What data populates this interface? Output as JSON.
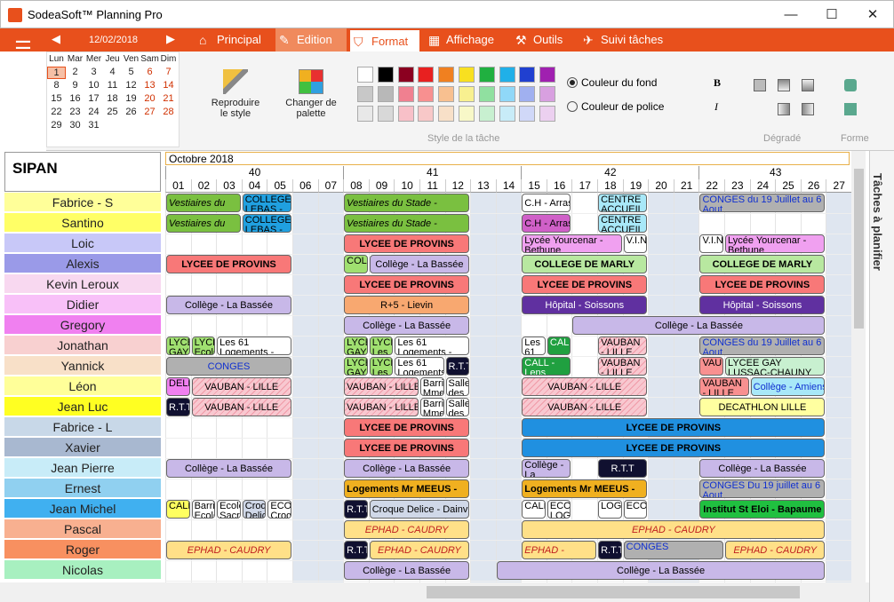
{
  "app": {
    "title": "SodeaSoft™ Planning Pro",
    "controls": [
      "—",
      "☐",
      "✕"
    ]
  },
  "nav": {
    "date": "12/02/2018",
    "prev": "◀",
    "next": "▶",
    "menu": "☰"
  },
  "tabs": [
    {
      "label": "Principal",
      "icon": "⌂"
    },
    {
      "label": "Edition",
      "icon": "✎"
    },
    {
      "label": "Format",
      "icon": "⛉"
    },
    {
      "label": "Affichage",
      "icon": "▦"
    },
    {
      "label": "Outils",
      "icon": "⚒"
    },
    {
      "label": "Suivi tâches",
      "icon": "✈"
    }
  ],
  "calendar": {
    "headers": [
      "Lun",
      "Mar",
      "Mer",
      "Jeu",
      "Ven",
      "Sam",
      "Dim"
    ],
    "weeks": [
      [
        "1",
        "2",
        "3",
        "4",
        "5",
        "6",
        "7"
      ],
      [
        "8",
        "9",
        "10",
        "11",
        "12",
        "13",
        "14"
      ],
      [
        "15",
        "16",
        "17",
        "18",
        "19",
        "20",
        "21"
      ],
      [
        "22",
        "23",
        "24",
        "25",
        "26",
        "27",
        "28"
      ],
      [
        "29",
        "30",
        "31",
        "",
        "",
        "",
        ""
      ]
    ]
  },
  "ribbon": {
    "reproduce": "Reproduire le style",
    "palette": "Changer de palette",
    "style_group": "Style de la tâche",
    "gradient_group": "Dégradé",
    "shape_group": "Forme",
    "bg_color": "Couleur du fond",
    "font_color": "Couleur de police",
    "bold": "B",
    "italic": "I",
    "swatches": [
      [
        "#ffffff",
        "#000000",
        "#8b0020",
        "#e82020",
        "#f08020",
        "#f8e020",
        "#20b040",
        "#20b0e8",
        "#2040d0",
        "#a020b0"
      ],
      [
        "#c8c8c8",
        "#b8b8b8",
        "#f08090",
        "#f89090",
        "#f8c090",
        "#f8f090",
        "#90e0a0",
        "#90d8f8",
        "#a0b0f0",
        "#d8a0e0"
      ],
      [
        "#e8e8e8",
        "#d8d8d8",
        "#f8c0c8",
        "#f8c8c8",
        "#f8e0c8",
        "#f8f8c8",
        "#c8f0d0",
        "#c8ecf8",
        "#d0d8f8",
        "#ecd0f0"
      ]
    ]
  },
  "schedule": {
    "title": "SIPAN",
    "month": "Octobre 2018",
    "weeks": [
      {
        "label": "40",
        "start": 0,
        "span": 7
      },
      {
        "label": "41",
        "start": 7,
        "span": 7
      },
      {
        "label": "42",
        "start": 14,
        "span": 7
      },
      {
        "label": "43",
        "start": 21,
        "span": 6
      }
    ],
    "days": [
      "01",
      "02",
      "03",
      "04",
      "05",
      "06",
      "07",
      "08",
      "09",
      "10",
      "11",
      "12",
      "13",
      "14",
      "15",
      "16",
      "17",
      "18",
      "19",
      "20",
      "21",
      "22",
      "23",
      "24",
      "25",
      "26",
      "27"
    ],
    "weekend": [
      5,
      6,
      12,
      13,
      19,
      20,
      26
    ],
    "resources": [
      {
        "name": "Fabrice - S",
        "color": "#ffff99"
      },
      {
        "name": "Santino",
        "color": "#ffff66"
      },
      {
        "name": "Loic",
        "color": "#c8c8f8"
      },
      {
        "name": "Alexis",
        "color": "#9a9ae8"
      },
      {
        "name": "Kevin Leroux",
        "color": "#f8d8f0"
      },
      {
        "name": "Didier",
        "color": "#f8c0f8"
      },
      {
        "name": "Gregory",
        "color": "#f080f0"
      },
      {
        "name": "Jonathan",
        "color": "#f8d0d0"
      },
      {
        "name": "Yannick",
        "color": "#f8e0c8"
      },
      {
        "name": "Léon",
        "color": "#ffff99"
      },
      {
        "name": "Jean Luc",
        "color": "#ffff22"
      },
      {
        "name": "Fabrice - L",
        "color": "#c8d8e8"
      },
      {
        "name": "Xavier",
        "color": "#a8b8d0"
      },
      {
        "name": "Jean Pierre",
        "color": "#c8ecf8"
      },
      {
        "name": "Ernest",
        "color": "#90d0f0"
      },
      {
        "name": "Jean Michel",
        "color": "#40b0f0"
      },
      {
        "name": "Pascal",
        "color": "#f8b090"
      },
      {
        "name": "Roger",
        "color": "#f89060"
      },
      {
        "name": "Nicolas",
        "color": "#a8f0c0"
      }
    ],
    "events": [
      {
        "r": 0,
        "s": 0,
        "e": 3,
        "t": "Vestiaires du Stade - Annequin",
        "bg": "#7ac040",
        "st": "l it"
      },
      {
        "r": 0,
        "s": 3,
        "e": 5,
        "t": "COLLEGE LEBAS -",
        "bg": "#20a0e0",
        "st": "l"
      },
      {
        "r": 0,
        "s": 7,
        "e": 12,
        "t": "Vestiaires du Stade - Annequin",
        "bg": "#7ac040",
        "st": "l it"
      },
      {
        "r": 0,
        "s": 14,
        "e": 16,
        "t": "C.H - Arras",
        "bg": "#ffffff",
        "st": "m"
      },
      {
        "r": 0,
        "s": 17,
        "e": 19,
        "t": "CENTRE ACCUEIL -",
        "bg": "#a8e8f8",
        "st": "l"
      },
      {
        "r": 0,
        "s": 21,
        "e": 26,
        "t": "CONGES du 19 Juillet au 6 Aout",
        "bg": "#b0b0b0",
        "st": "l",
        "fc": "#1030d0"
      },
      {
        "r": 1,
        "s": 0,
        "e": 3,
        "t": "Vestiaires du Stade - Annequin",
        "bg": "#7ac040",
        "st": "l it"
      },
      {
        "r": 1,
        "s": 3,
        "e": 5,
        "t": "COLLEGE LEBAS -",
        "bg": "#20a0e0",
        "st": "l"
      },
      {
        "r": 1,
        "s": 7,
        "e": 12,
        "t": "Vestiaires du Stade - Annequin",
        "bg": "#7ac040",
        "st": "l it"
      },
      {
        "r": 1,
        "s": 14,
        "e": 16,
        "t": "C.H - Arras",
        "bg": "#d060c8",
        "st": "m"
      },
      {
        "r": 1,
        "s": 17,
        "e": 19,
        "t": "CENTRE ACCUEIL -",
        "bg": "#a8e8f8",
        "st": "l"
      },
      {
        "r": 2,
        "s": 7,
        "e": 12,
        "t": "LYCEE DE PROVINS",
        "bg": "#f87878",
        "st": "b"
      },
      {
        "r": 2,
        "s": 14,
        "e": 18,
        "t": "Lycée Yourcenar - Bethune",
        "bg": "#f0a0f0",
        "st": "l"
      },
      {
        "r": 2,
        "s": 18,
        "e": 19,
        "t": "V.I.N",
        "bg": "#ffffff",
        "st": "l"
      },
      {
        "r": 2,
        "s": 21,
        "e": 22,
        "t": "V.I.N",
        "bg": "#ffffff",
        "st": "l"
      },
      {
        "r": 2,
        "s": 22,
        "e": 26,
        "t": "Lycée Yourcenar - Bethune",
        "bg": "#f0a0f0",
        "st": "l"
      },
      {
        "r": 3,
        "s": 0,
        "e": 5,
        "t": "LYCEE DE PROVINS",
        "bg": "#f87878",
        "st": "b"
      },
      {
        "r": 3,
        "s": 7,
        "e": 8,
        "t": "COLL",
        "bg": "#a0e070",
        "st": "l"
      },
      {
        "r": 3,
        "s": 8,
        "e": 12,
        "t": "Collège - La Bassée",
        "bg": "#c8b8e8",
        "st": "m"
      },
      {
        "r": 3,
        "s": 14,
        "e": 19,
        "t": "COLLEGE DE MARLY",
        "bg": "#b8e8a0",
        "st": "b"
      },
      {
        "r": 3,
        "s": 21,
        "e": 26,
        "t": "COLLEGE DE MARLY",
        "bg": "#b8e8a0",
        "st": "b"
      },
      {
        "r": 4,
        "s": 7,
        "e": 12,
        "t": "LYCEE DE PROVINS",
        "bg": "#f87878",
        "st": "b"
      },
      {
        "r": 4,
        "s": 14,
        "e": 19,
        "t": "LYCEE DE PROVINS",
        "bg": "#f87878",
        "st": "b"
      },
      {
        "r": 4,
        "s": 21,
        "e": 26,
        "t": "LYCEE DE PROVINS",
        "bg": "#f87878",
        "st": "b"
      },
      {
        "r": 5,
        "s": 0,
        "e": 5,
        "t": "Collège - La Bassée",
        "bg": "#c8b8e8",
        "st": "m"
      },
      {
        "r": 5,
        "s": 7,
        "e": 12,
        "t": "R+5 - Lievin",
        "bg": "#f8a870",
        "st": "m"
      },
      {
        "r": 5,
        "s": 14,
        "e": 19,
        "t": "Hôpital - Soissons",
        "bg": "#6030a0",
        "st": "m",
        "fc": "#ffffff"
      },
      {
        "r": 5,
        "s": 21,
        "e": 26,
        "t": "Hôpital - Soissons",
        "bg": "#6030a0",
        "st": "m",
        "fc": "#ffffff"
      },
      {
        "r": 6,
        "s": 7,
        "e": 12,
        "t": "Collège - La Bassée",
        "bg": "#c8b8e8",
        "st": "m"
      },
      {
        "r": 6,
        "s": 16,
        "e": 26,
        "t": "Collège - La Bassée",
        "bg": "#c8b8e8",
        "st": "m"
      },
      {
        "r": 7,
        "s": 0,
        "e": 1,
        "t": "LYCE GAY",
        "bg": "#a0e070",
        "st": "l"
      },
      {
        "r": 7,
        "s": 1,
        "e": 2,
        "t": "LYCE Ecole",
        "bg": "#a0e070",
        "st": "l"
      },
      {
        "r": 7,
        "s": 2,
        "e": 5,
        "t": "Les 61 Logements -",
        "bg": "#ffffff",
        "st": "l"
      },
      {
        "r": 7,
        "s": 7,
        "e": 8,
        "t": "LYCE GAY",
        "bg": "#a0e070",
        "st": "l"
      },
      {
        "r": 7,
        "s": 8,
        "e": 9,
        "t": "LYCE Les",
        "bg": "#a0e070",
        "st": "l"
      },
      {
        "r": 7,
        "s": 9,
        "e": 12,
        "t": "Les 61 Logements -",
        "bg": "#ffffff",
        "st": "l"
      },
      {
        "r": 7,
        "s": 14,
        "e": 15,
        "t": "Les 61",
        "bg": "#ffffff",
        "st": "l"
      },
      {
        "r": 7,
        "s": 15,
        "e": 16,
        "t": "CALL",
        "bg": "#20a040",
        "st": "l",
        "fc": "#ffffff"
      },
      {
        "r": 7,
        "s": 17,
        "e": 19,
        "t": "VAUBAN - LILLE",
        "bg": "#f8c8d0",
        "st": "l"
      },
      {
        "r": 7,
        "s": 21,
        "e": 26,
        "t": "CONGES du 19 Juillet au 6 Aout",
        "bg": "#b0b0b0",
        "st": "l",
        "fc": "#1030d0"
      },
      {
        "r": 8,
        "s": 0,
        "e": 5,
        "t": "CONGES",
        "bg": "#b0b0b0",
        "st": "m",
        "fc": "#1030d0"
      },
      {
        "r": 8,
        "s": 7,
        "e": 8,
        "t": "LYCE GAY",
        "bg": "#a0e070",
        "st": "l"
      },
      {
        "r": 8,
        "s": 8,
        "e": 9,
        "t": "LYCE Les",
        "bg": "#a0e070",
        "st": "l"
      },
      {
        "r": 8,
        "s": 9,
        "e": 11,
        "t": "Les 61 Logements",
        "bg": "#ffffff",
        "st": "l"
      },
      {
        "r": 8,
        "s": 11,
        "e": 12,
        "t": "R.T.T",
        "bg": "#101030",
        "st": "m",
        "fc": "#ffffff"
      },
      {
        "r": 8,
        "s": 14,
        "e": 16,
        "t": "CALL - Lens",
        "bg": "#20a040",
        "st": "l",
        "fc": "#ffffff"
      },
      {
        "r": 8,
        "s": 17,
        "e": 19,
        "t": "VAUBAN - LILLE",
        "bg": "#f8c8d0",
        "st": "l"
      },
      {
        "r": 8,
        "s": 21,
        "e": 22,
        "t": "VAUB",
        "bg": "#f89090",
        "st": "l"
      },
      {
        "r": 8,
        "s": 22,
        "e": 26,
        "t": "LYCEE GAY LUSSAC-CHAUNY",
        "bg": "#c8f0d0",
        "st": "l"
      },
      {
        "r": 9,
        "s": 0,
        "e": 1,
        "t": "DELE",
        "bg": "#f080f0",
        "st": "l"
      },
      {
        "r": 9,
        "s": 1,
        "e": 5,
        "t": "VAUBAN - LILLE",
        "bg": "#f8c8d0",
        "st": "m"
      },
      {
        "r": 9,
        "s": 7,
        "e": 10,
        "t": "VAUBAN - LILLE",
        "bg": "#f8c8d0",
        "st": "m"
      },
      {
        "r": 9,
        "s": 10,
        "e": 11,
        "t": "Barris Mme",
        "bg": "#ffffff",
        "st": "l"
      },
      {
        "r": 9,
        "s": 11,
        "e": 12,
        "t": "Salle des",
        "bg": "#ffffff",
        "st": "l"
      },
      {
        "r": 9,
        "s": 14,
        "e": 19,
        "t": "VAUBAN - LILLE",
        "bg": "#f8c8d0",
        "st": "m"
      },
      {
        "r": 9,
        "s": 21,
        "e": 23,
        "t": "VAUBAN - LILLE",
        "bg": "#f89090",
        "st": "l"
      },
      {
        "r": 9,
        "s": 23,
        "e": 26,
        "t": "Collège - Amiens",
        "bg": "#a8e8f8",
        "st": "m",
        "fc": "#1030d0"
      },
      {
        "r": 10,
        "s": 0,
        "e": 1,
        "t": "R.T.T",
        "bg": "#101030",
        "st": "m",
        "fc": "#ffffff"
      },
      {
        "r": 10,
        "s": 1,
        "e": 5,
        "t": "VAUBAN - LILLE",
        "bg": "#f8c8d0",
        "st": "m"
      },
      {
        "r": 10,
        "s": 7,
        "e": 10,
        "t": "VAUBAN - LILLE",
        "bg": "#f8c8d0",
        "st": "m"
      },
      {
        "r": 10,
        "s": 10,
        "e": 11,
        "t": "Barris Mme",
        "bg": "#ffffff",
        "st": "l"
      },
      {
        "r": 10,
        "s": 11,
        "e": 12,
        "t": "Salle des",
        "bg": "#ffffff",
        "st": "l"
      },
      {
        "r": 10,
        "s": 14,
        "e": 19,
        "t": "VAUBAN - LILLE",
        "bg": "#f8c8d0",
        "st": "m"
      },
      {
        "r": 10,
        "s": 21,
        "e": 26,
        "t": "DECATHLON LILLE",
        "bg": "#ffffa0",
        "st": "m"
      },
      {
        "r": 11,
        "s": 7,
        "e": 12,
        "t": "LYCEE DE PROVINS",
        "bg": "#f87878",
        "st": "b"
      },
      {
        "r": 11,
        "s": 14,
        "e": 26,
        "t": "LYCEE DE PROVINS",
        "bg": "#2090e0",
        "st": "b"
      },
      {
        "r": 12,
        "s": 7,
        "e": 12,
        "t": "LYCEE DE PROVINS",
        "bg": "#f87878",
        "st": "b"
      },
      {
        "r": 12,
        "s": 14,
        "e": 26,
        "t": "LYCEE DE PROVINS",
        "bg": "#2090e0",
        "st": "b"
      },
      {
        "r": 13,
        "s": 0,
        "e": 5,
        "t": "Collège - La Bassée",
        "bg": "#c8b8e8",
        "st": "m"
      },
      {
        "r": 13,
        "s": 7,
        "e": 12,
        "t": "Collège - La Bassée",
        "bg": "#c8b8e8",
        "st": "m"
      },
      {
        "r": 13,
        "s": 14,
        "e": 16,
        "t": "Collège - La Bassée",
        "bg": "#c8b8e8",
        "st": "l"
      },
      {
        "r": 13,
        "s": 17,
        "e": 19,
        "t": "R.T.T",
        "bg": "#101030",
        "st": "m",
        "fc": "#ffffff"
      },
      {
        "r": 13,
        "s": 21,
        "e": 26,
        "t": "Collège - La Bassée",
        "bg": "#c8b8e8",
        "st": "m"
      },
      {
        "r": 14,
        "s": 7,
        "e": 12,
        "t": "Logements Mr MEEUS - Douvrez",
        "bg": "#f0b020",
        "st": "l b"
      },
      {
        "r": 14,
        "s": 14,
        "e": 19,
        "t": "Logements Mr MEEUS - Douvrez",
        "bg": "#f0b020",
        "st": "l b"
      },
      {
        "r": 14,
        "s": 21,
        "e": 26,
        "t": "CONGES Du 19 juillet au 6 Aout",
        "bg": "#b0b0b0",
        "st": "l",
        "fc": "#1030d0"
      },
      {
        "r": 15,
        "s": 0,
        "e": 1,
        "t": "CALL",
        "bg": "#ffff60",
        "st": "l"
      },
      {
        "r": 15,
        "s": 1,
        "e": 2,
        "t": "Barris Ecole",
        "bg": "#ffffff",
        "st": "l"
      },
      {
        "r": 15,
        "s": 2,
        "e": 3,
        "t": "Ecole Sacré",
        "bg": "#ffffff",
        "st": "l"
      },
      {
        "r": 15,
        "s": 3,
        "e": 4,
        "t": "Croq Delice",
        "bg": "#d0d8e8",
        "st": "l"
      },
      {
        "r": 15,
        "s": 4,
        "e": 5,
        "t": "ECOL Croqu",
        "bg": "#ffffff",
        "st": "l"
      },
      {
        "r": 15,
        "s": 7,
        "e": 8,
        "t": "R.T.T",
        "bg": "#101030",
        "st": "m",
        "fc": "#ffffff"
      },
      {
        "r": 15,
        "s": 8,
        "e": 12,
        "t": "Croque Delice - Dainville",
        "bg": "#d0d8e8",
        "st": "m"
      },
      {
        "r": 15,
        "s": 14,
        "e": 15,
        "t": "CALL",
        "bg": "#ffffff",
        "st": "l"
      },
      {
        "r": 15,
        "s": 15,
        "e": 16,
        "t": "ECOL LOGE",
        "bg": "#ffffff",
        "st": "l"
      },
      {
        "r": 15,
        "s": 17,
        "e": 18,
        "t": "LOGE",
        "bg": "#ffffff",
        "st": "l"
      },
      {
        "r": 15,
        "s": 18,
        "e": 19,
        "t": "ECOL",
        "bg": "#ffffff",
        "st": "l"
      },
      {
        "r": 15,
        "s": 21,
        "e": 26,
        "t": "Institut St Eloi - Bapaume",
        "bg": "#20c040",
        "st": "b"
      },
      {
        "r": 16,
        "s": 7,
        "e": 12,
        "t": "EPHAD - CAUDRY",
        "bg": "#ffe088",
        "st": "it",
        "fc": "#c02020"
      },
      {
        "r": 16,
        "s": 14,
        "e": 26,
        "t": "EPHAD - CAUDRY",
        "bg": "#ffe088",
        "st": "it",
        "fc": "#c02020"
      },
      {
        "r": 17,
        "s": 0,
        "e": 5,
        "t": "EPHAD - CAUDRY",
        "bg": "#ffe088",
        "st": "it",
        "fc": "#c02020"
      },
      {
        "r": 17,
        "s": 7,
        "e": 8,
        "t": "R.T.T",
        "bg": "#101030",
        "st": "m",
        "fc": "#ffffff"
      },
      {
        "r": 17,
        "s": 8,
        "e": 12,
        "t": "EPHAD - CAUDRY",
        "bg": "#ffe088",
        "st": "it",
        "fc": "#c02020"
      },
      {
        "r": 17,
        "s": 14,
        "e": 17,
        "t": "EPHAD - CAUDRY",
        "bg": "#ffe088",
        "st": "l it",
        "fc": "#c02020"
      },
      {
        "r": 17,
        "s": 17,
        "e": 18,
        "t": "R.T.T",
        "bg": "#101030",
        "st": "m",
        "fc": "#ffffff"
      },
      {
        "r": 17,
        "s": 18,
        "e": 22,
        "t": "CONGES",
        "bg": "#b0b0b0",
        "st": "l",
        "fc": "#1030d0"
      },
      {
        "r": 17,
        "s": 22,
        "e": 26,
        "t": "EPHAD - CAUDRY",
        "bg": "#ffe088",
        "st": "it",
        "fc": "#c02020"
      },
      {
        "r": 18,
        "s": 7,
        "e": 12,
        "t": "Collège - La Bassée",
        "bg": "#c8b8e8",
        "st": "m"
      },
      {
        "r": 18,
        "s": 13,
        "e": 26,
        "t": "Collège - La Bassée",
        "bg": "#c8b8e8",
        "st": "m"
      }
    ]
  },
  "side": {
    "label": "Tâches à planifier"
  }
}
